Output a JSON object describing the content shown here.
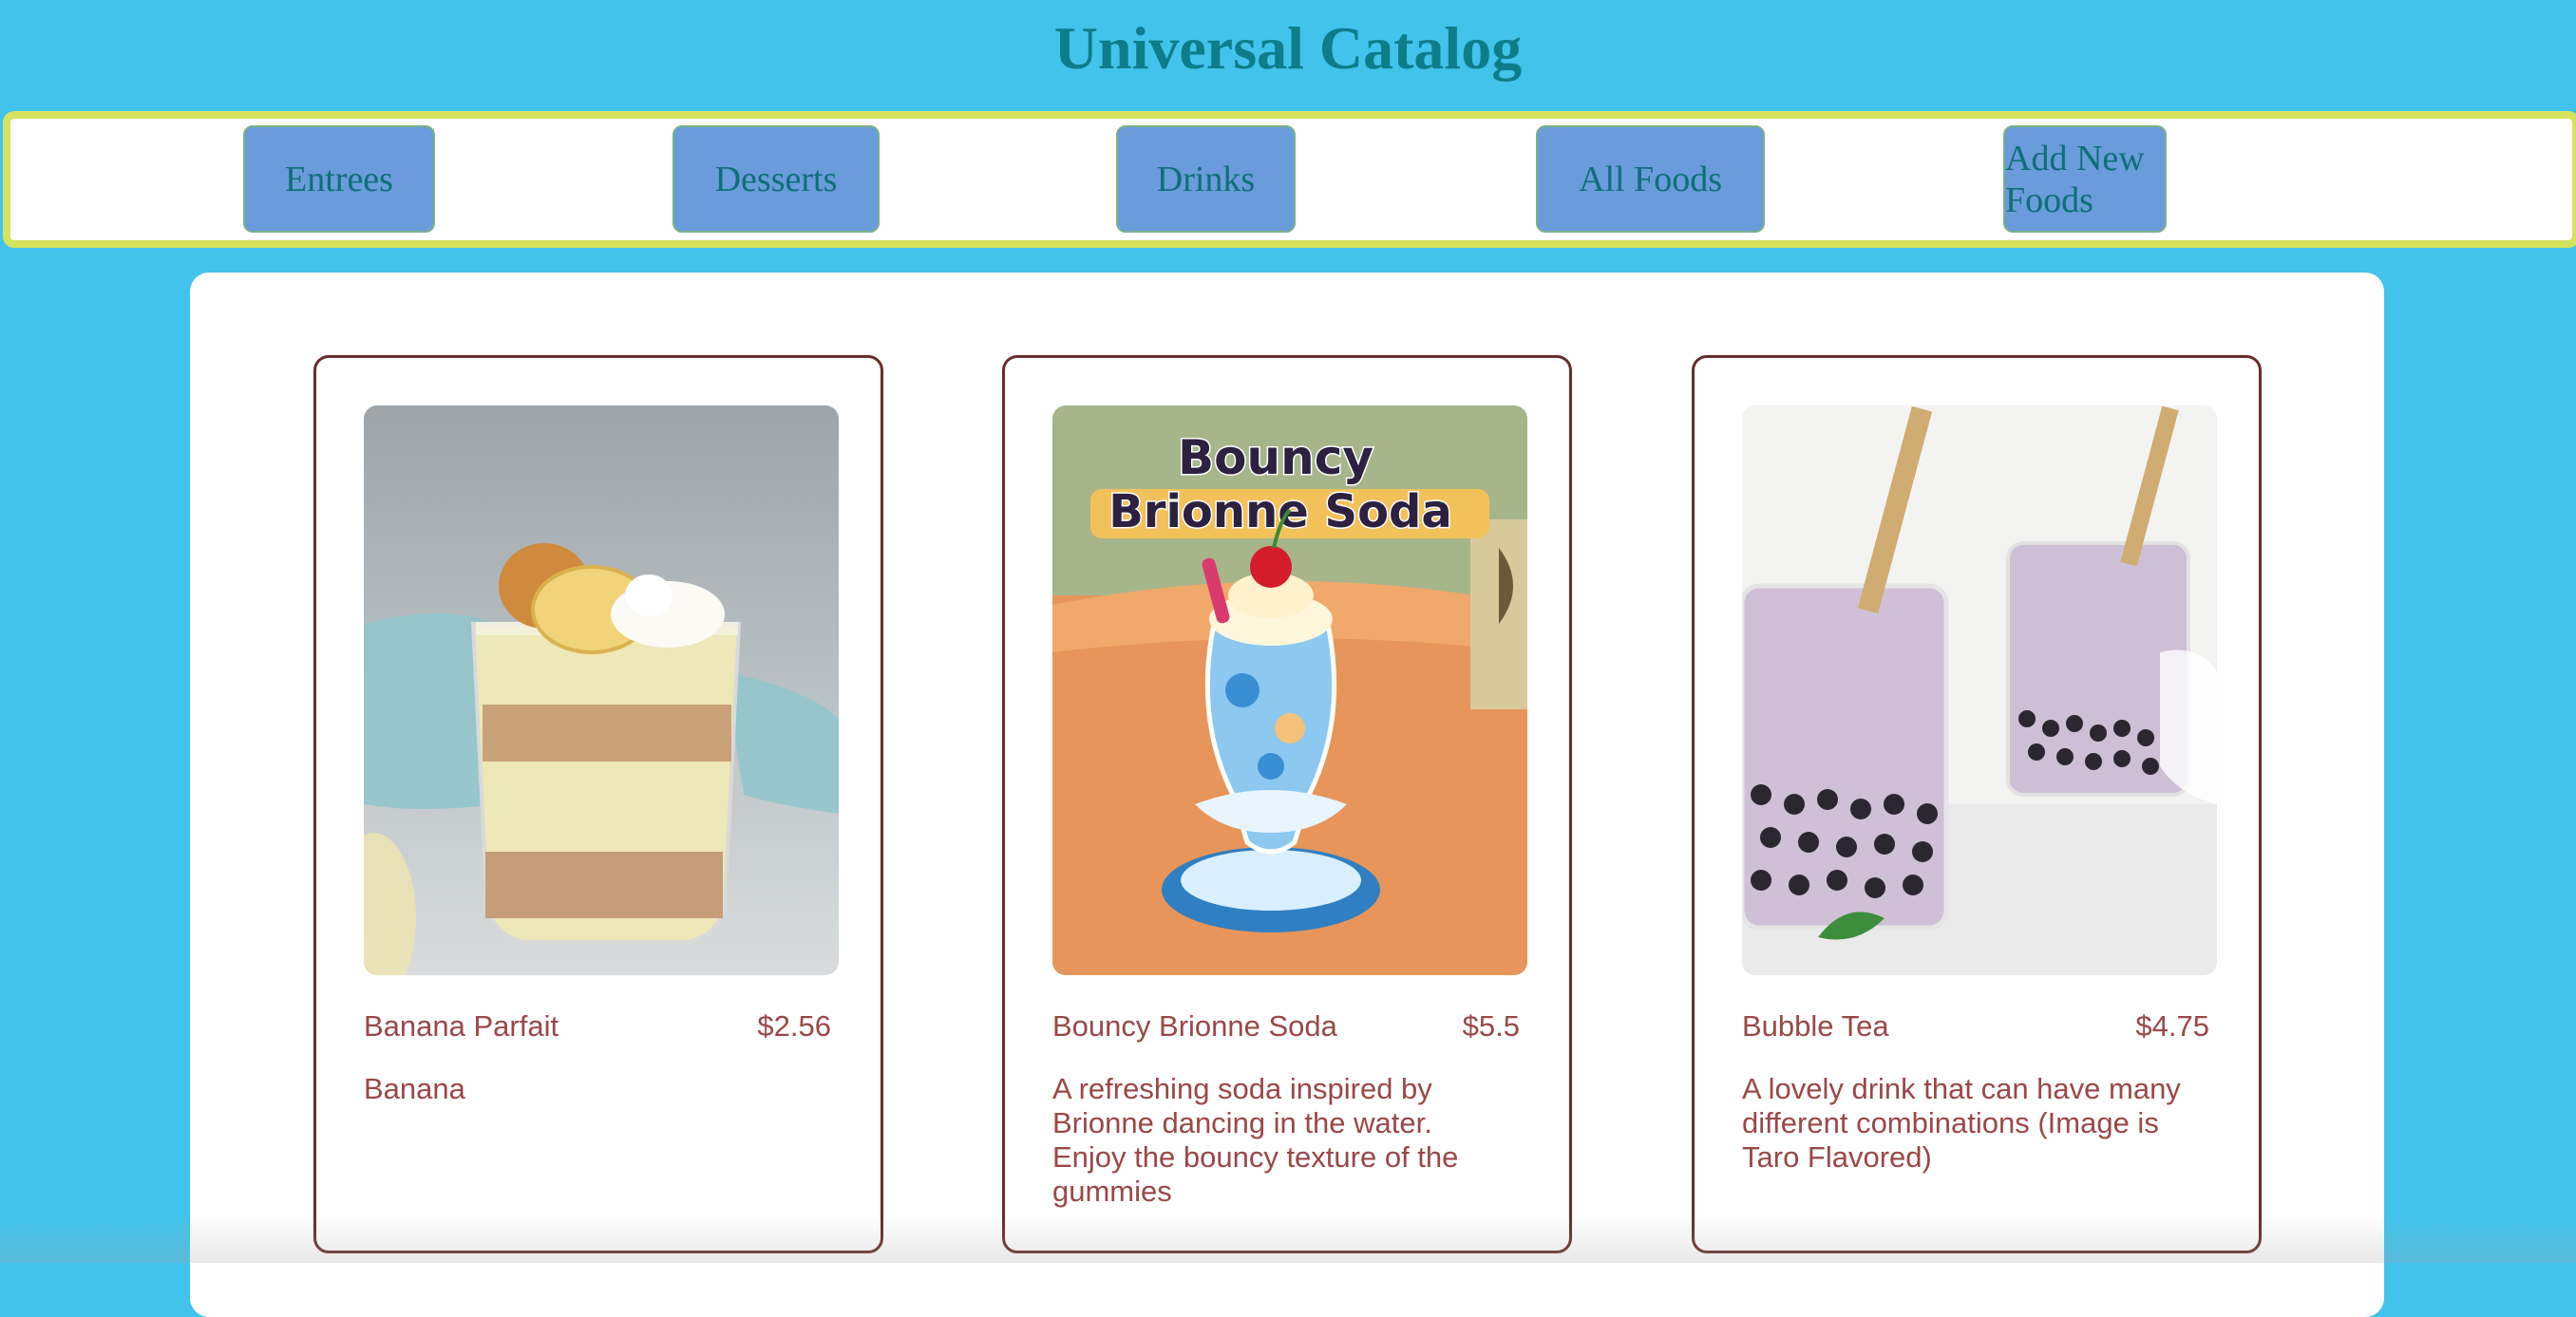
{
  "header": {
    "title": "Universal Catalog"
  },
  "nav": {
    "items": [
      {
        "label": "Entrees"
      },
      {
        "label": "Desserts"
      },
      {
        "label": "Drinks"
      },
      {
        "label": "All Foods"
      },
      {
        "label": "Add New Foods"
      }
    ]
  },
  "products": [
    {
      "name": "Banana Parfait",
      "price": "$2.56",
      "description": "Banana",
      "image": "banana-parfait-photo"
    },
    {
      "name": "Bouncy Brionne Soda",
      "price": "$5.5",
      "description": "A refreshing soda inspired by Brionne dancing in the water. Enjoy the bouncy texture of the gummies",
      "image": "bouncy-brionne-soda-illustration",
      "image_text": [
        "Bouncy",
        "Brionne Soda"
      ]
    },
    {
      "name": "Bubble Tea",
      "price": "$4.75",
      "description": "A lovely drink that can have many different combinations (Image is Taro Flavored)",
      "image": "taro-bubble-tea-photo"
    }
  ],
  "colors": {
    "background": "#42c3ec",
    "title": "#0e7d89",
    "nav_border": "#d6e35e",
    "nav_button": "#6a9bdb",
    "card_border": "#6b2d2d",
    "card_text": "#9b4747"
  }
}
